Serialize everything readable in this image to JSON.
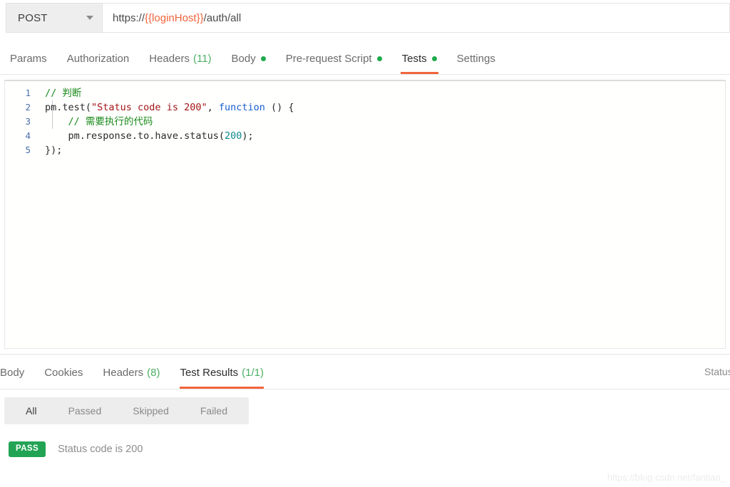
{
  "request_bar": {
    "method": "POST",
    "method_caret_icon": "chevron-down-icon",
    "url_prefix": "https://",
    "url_variable": "{{loginHost}}",
    "url_suffix": "/auth/all",
    "url_full": "https://{{loginHost}}/auth/all"
  },
  "request_tabs": [
    {
      "label": "Params",
      "count": "",
      "dot": false,
      "active": false
    },
    {
      "label": "Authorization",
      "count": "",
      "dot": false,
      "active": false
    },
    {
      "label": "Headers",
      "count": "(11)",
      "dot": false,
      "active": false
    },
    {
      "label": "Body",
      "count": "",
      "dot": true,
      "active": false
    },
    {
      "label": "Pre-request Script",
      "count": "",
      "dot": true,
      "active": false
    },
    {
      "label": "Tests",
      "count": "",
      "dot": true,
      "active": true
    },
    {
      "label": "Settings",
      "count": "",
      "dot": false,
      "active": false
    }
  ],
  "editor": {
    "language": "javascript",
    "lines": [
      {
        "number": "1",
        "text": "// 判断"
      },
      {
        "number": "2",
        "text": "pm.test(\"Status code is 200\", function () {"
      },
      {
        "number": "3",
        "text": "    // 需要执行的代码"
      },
      {
        "number": "4",
        "text": "    pm.response.to.have.status(200);"
      },
      {
        "number": "5",
        "text": "});"
      }
    ],
    "tokens": {
      "l1_comment": "// 判断",
      "l2_a": "pm.test(",
      "l2_string": "\"Status code is 200\"",
      "l2_b": ", ",
      "l2_kw": "function",
      "l2_c": " () {",
      "l3_comment": "// 需要执行的代码",
      "l4_a": "pm.response.to.have.status(",
      "l4_num": "200",
      "l4_b": ");",
      "l5": "});"
    }
  },
  "response_tabs": [
    {
      "label": "Body",
      "count": "",
      "active": false
    },
    {
      "label": "Cookies",
      "count": "",
      "active": false
    },
    {
      "label": "Headers",
      "count": "(8)",
      "active": false
    },
    {
      "label": "Test Results",
      "count": "(1/1)",
      "active": true
    }
  ],
  "response_meta": {
    "status_label": "Status"
  },
  "result_filters": [
    {
      "label": "All",
      "active": true
    },
    {
      "label": "Passed",
      "active": false
    },
    {
      "label": "Skipped",
      "active": false
    },
    {
      "label": "Failed",
      "active": false
    }
  ],
  "test_results": [
    {
      "status": "PASS",
      "name": "Status code is 200"
    }
  ],
  "watermark": "https://blog.csdn.net/fantian_",
  "colors": {
    "accent_orange": "#f1643b",
    "pass_green": "#23a455",
    "dot_green": "#1faa4b",
    "count_green": "#4caf63",
    "variable_orange": "#f1643b"
  }
}
